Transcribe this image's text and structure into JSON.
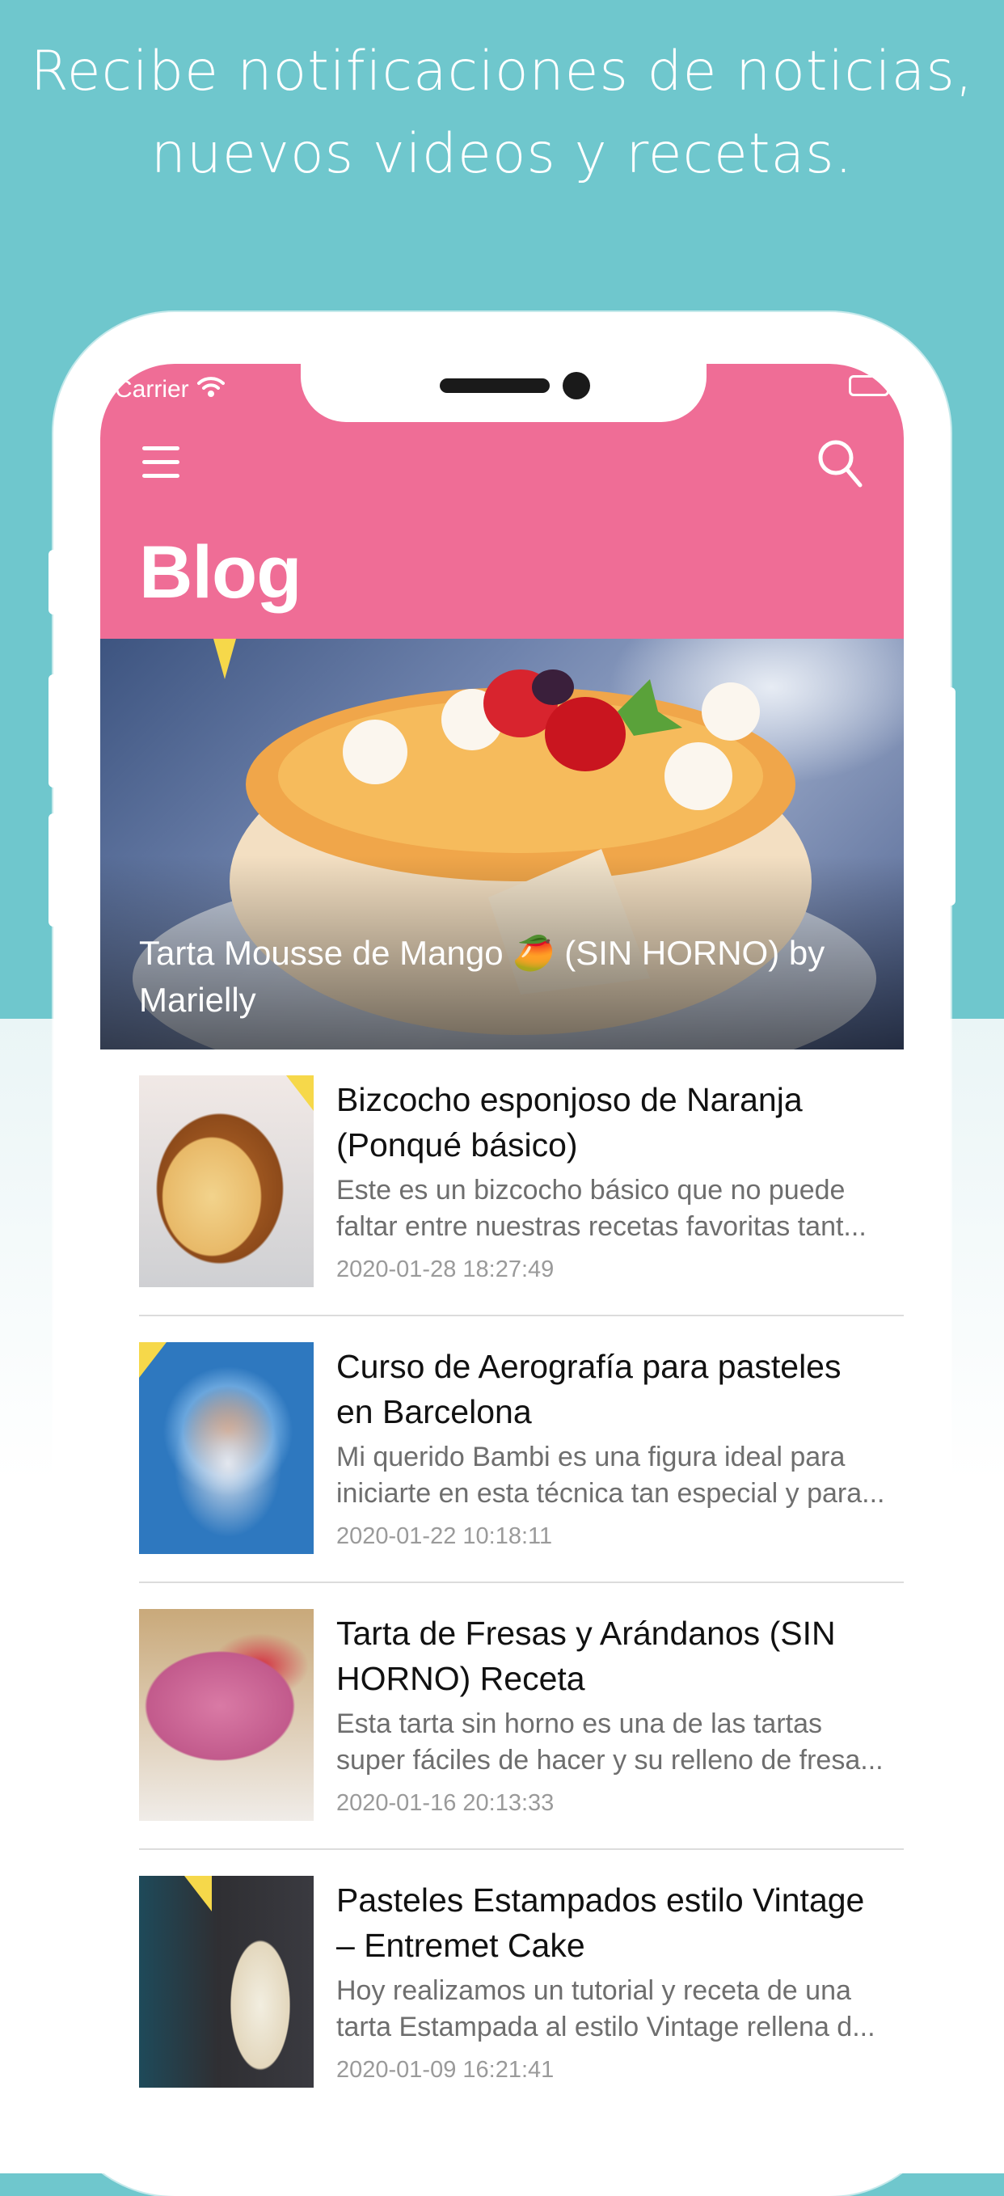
{
  "headline": [
    "Recibe notificaciones de noticias,",
    "nuevos videos y recetas."
  ],
  "status_bar": {
    "carrier": "Carrier"
  },
  "appbar": {
    "title": "Blog",
    "menu_icon": "hamburger-menu-icon",
    "search_icon": "search-icon",
    "color": "#ef6d96"
  },
  "hero": {
    "title": "Tarta Mousse de Mango 🥭 (SIN HORNO) by Marielly"
  },
  "posts": [
    {
      "title": "Bizcocho esponjoso de Naranja (Ponqué básico)",
      "excerpt": "Este es un bizcocho básico que no puede faltar entre nuestras recetas favoritas tant...",
      "date": "2020-01-28 18:27:49"
    },
    {
      "title": "Curso de Aerografía para pasteles en Barcelona",
      "excerpt": "Mi querido Bambi es una figura ideal para iniciarte en esta técnica tan especial y para...",
      "date": "2020-01-22 10:18:11"
    },
    {
      "title": "Tarta de Fresas y Arándanos (SIN HORNO) Receta",
      "excerpt": "Esta tarta sin horno es una de las tartas super fáciles de hacer y su relleno de fresa...",
      "date": "2020-01-16 20:13:33"
    },
    {
      "title": "Pasteles Estampados estilo Vintage – Entremet Cake",
      "excerpt": "Hoy realizamos un tutorial y receta de una tarta Estampada al estilo Vintage rellena d...",
      "date": "2020-01-09 16:21:41"
    }
  ],
  "colors": {
    "background": "#6fc7cd",
    "accent": "#ef6d96"
  }
}
